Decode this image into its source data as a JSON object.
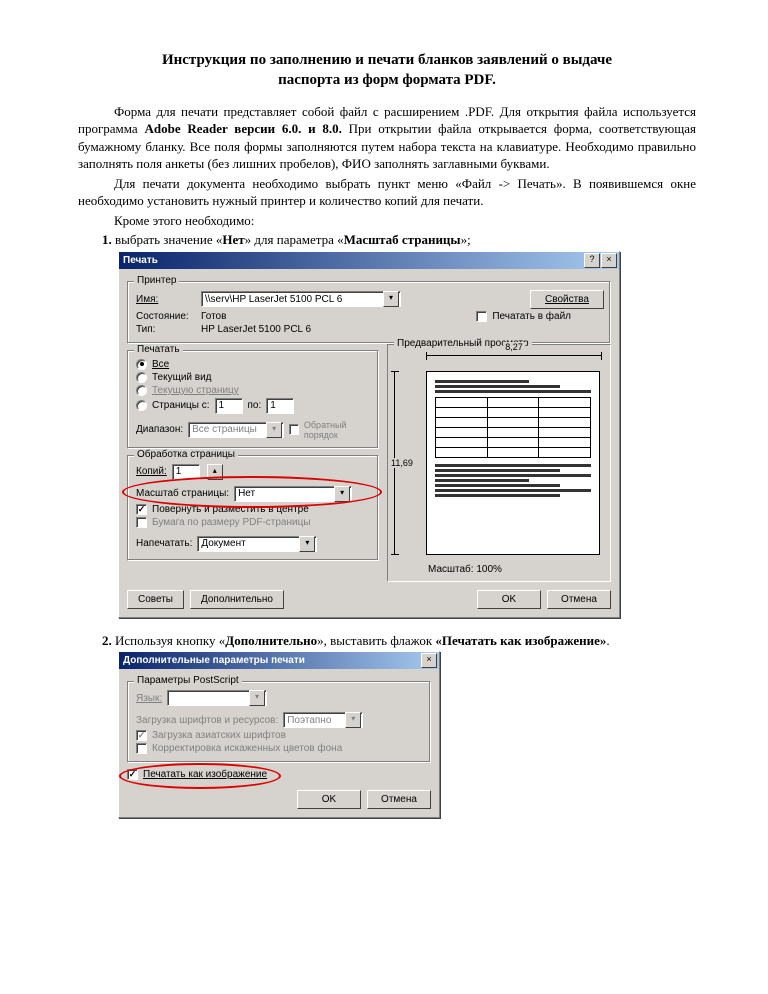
{
  "title_line1": "Инструкция по заполнению и печати бланков заявлений о выдаче",
  "title_line2": "паспорта из форм формата PDF.",
  "para1_a": "Форма для печати представляет собой файл с расширением .PDF. Для открытия файла используется программа ",
  "para1_b": "Adobe Reader версии 6.0. и 8.0.",
  "para1_c": " При открытии файла открывается форма, соответствующая бумажному бланку. Все поля формы заполняются путем набора текста на клавиатуре. Необходимо правильно заполнять поля анкеты (без лишних пробелов), ФИО заполнять заглавными буквами.",
  "para2": "Для печати документа необходимо выбрать пункт меню «Файл -> Печать». В появившемся окне необходимо установить нужный принтер и количество копий для печати.",
  "para3": "Кроме этого необходимо:",
  "li1_num": "1.",
  "li1_a": "выбрать значение «",
  "li1_b": "Нет",
  "li1_c": "» для параметра «",
  "li1_d": "Масштаб страницы",
  "li1_e": "»;",
  "li2_num": "2.",
  "li2_a": "Используя кнопку «",
  "li2_b": "Дополнительно",
  "li2_c": "», выставить флажок ",
  "li2_d": "«Печатать как изображение»",
  "li2_e": ".",
  "print": {
    "title": "Печать",
    "grp_printer": "Принтер",
    "lbl_name": "Имя:",
    "name_val": "\\\\serv\\HP LaserJet 5100 PCL 6",
    "lbl_state": "Состояние:",
    "state_val": "Готов",
    "lbl_type": "Тип:",
    "type_val": "HP LaserJet 5100 PCL 6",
    "btn_props": "Свойства",
    "cb_tofile": "Печатать в файл",
    "grp_range": "Печатать",
    "r_all": "Все",
    "r_cur": "Текущий вид",
    "r_page": "Текущую страницу",
    "r_pages": "Страницы  с:",
    "r_to": "по:",
    "r_from_v": "1",
    "r_to_v": "1",
    "lbl_diap": "Диапазон:",
    "diap_v": "Все страницы",
    "cb_rev": "Обратный порядок",
    "grp_hand": "Обработка страницы",
    "lbl_copies": "Копий:",
    "copies_v": "1",
    "lbl_scale": "Масштаб страницы:",
    "scale_v": "Нет",
    "cb_rotate": "Повернуть и разместить в центре",
    "cb_paper": "Бумага по размеру PDF-страницы",
    "lbl_what": "Напечатать:",
    "what_v": "Документ",
    "btn_tips": "Советы",
    "btn_adv": "Дополнительно",
    "btn_ok": "OK",
    "btn_cancel": "Отмена",
    "grp_preview": "Предварительный просмотр",
    "ruler_h": "8,27",
    "ruler_v": "11,69",
    "zoom": "Масштаб: 100%"
  },
  "adv": {
    "title": "Дополнительные параметры печати",
    "grp": "Параметры PostScript",
    "lbl_lang": "Язык:",
    "lbl_font": "Загрузка шрифтов и ресурсов:",
    "font_v": "Поэтапно",
    "cb_asian": "Загрузка азиатских шрифтов",
    "cb_color": "Корректировка искаженных цветов фона",
    "cb_asimage": "Печатать как изображение",
    "btn_ok": "OK",
    "btn_cancel": "Отмена"
  }
}
